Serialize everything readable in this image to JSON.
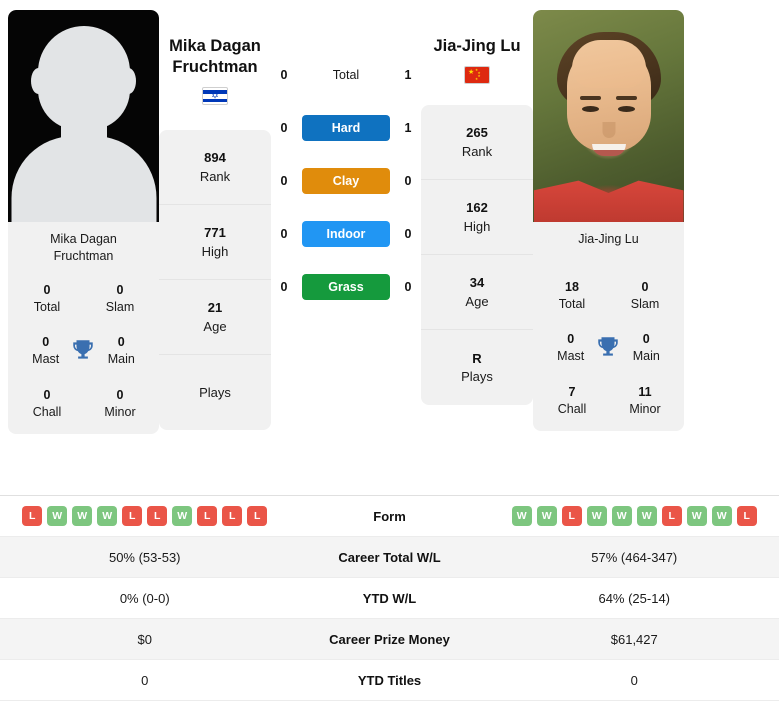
{
  "players": {
    "left": {
      "name": "Mika Dagan Fruchtman",
      "name_line1": "Mika Dagan",
      "name_line2": "Fruchtman",
      "photo_caption_line1": "Mika Dagan",
      "photo_caption_line2": "Fruchtman",
      "country": "Israel",
      "flag_icon": "israel-flag-icon",
      "avatar_type": "placeholder-avatar",
      "info": [
        {
          "value": "894",
          "label": "Rank"
        },
        {
          "value": "771",
          "label": "High"
        },
        {
          "value": "21",
          "label": "Age"
        },
        {
          "value": "",
          "label": "Plays"
        }
      ],
      "titles": [
        {
          "value": "0",
          "label": "Total"
        },
        {
          "value": "0",
          "label": "Slam"
        },
        {
          "value": "0",
          "label": "Mast"
        },
        {
          "value": "0",
          "label": "Main"
        },
        {
          "value": "0",
          "label": "Chall"
        },
        {
          "value": "0",
          "label": "Minor"
        }
      ],
      "form": [
        "L",
        "W",
        "W",
        "W",
        "L",
        "L",
        "W",
        "L",
        "L",
        "L"
      ],
      "career_total_wl": "50% (53-53)",
      "ytd_wl": "0% (0-0)",
      "career_prize_money": "$0",
      "ytd_titles": "0"
    },
    "right": {
      "name": "Jia-Jing Lu",
      "name_line1": "Jia-Jing Lu",
      "name_line2": "",
      "photo_caption_line1": "Jia-Jing Lu",
      "photo_caption_line2": "",
      "country": "China",
      "flag_icon": "china-flag-icon",
      "avatar_type": "player-photo",
      "info": [
        {
          "value": "265",
          "label": "Rank"
        },
        {
          "value": "162",
          "label": "High"
        },
        {
          "value": "34",
          "label": "Age"
        },
        {
          "value": "R",
          "label": "Plays"
        }
      ],
      "titles": [
        {
          "value": "18",
          "label": "Total"
        },
        {
          "value": "0",
          "label": "Slam"
        },
        {
          "value": "0",
          "label": "Mast"
        },
        {
          "value": "0",
          "label": "Main"
        },
        {
          "value": "7",
          "label": "Chall"
        },
        {
          "value": "11",
          "label": "Minor"
        }
      ],
      "form": [
        "W",
        "W",
        "L",
        "W",
        "W",
        "W",
        "L",
        "W",
        "W",
        "L"
      ],
      "career_total_wl": "57% (464-347)",
      "ytd_wl": "64% (25-14)",
      "career_prize_money": "$61,427",
      "ytd_titles": "0"
    }
  },
  "head_to_head": {
    "rows": [
      {
        "label": "Total",
        "left": "0",
        "right": "1",
        "color": ""
      },
      {
        "label": "Hard",
        "left": "0",
        "right": "1",
        "color": "#0f72c0"
      },
      {
        "label": "Clay",
        "left": "0",
        "right": "0",
        "color": "#e08c0c"
      },
      {
        "label": "Indoor",
        "left": "0",
        "right": "0",
        "color": "#2196f3"
      },
      {
        "label": "Grass",
        "left": "0",
        "right": "0",
        "color": "#159a3d"
      }
    ]
  },
  "stats_table": {
    "rows": [
      {
        "label": "Form"
      },
      {
        "label": "Career Total W/L"
      },
      {
        "label": "YTD W/L"
      },
      {
        "label": "Career Prize Money"
      },
      {
        "label": "YTD Titles"
      }
    ]
  },
  "colors": {
    "win_badge": "#7dc67f",
    "loss_badge": "#ea5548",
    "card_bg": "#f1f1f1",
    "trophy": "#3a6fb0",
    "hard": "#0f72c0",
    "clay": "#e08c0c",
    "indoor": "#2196f3",
    "grass": "#159a3d"
  },
  "icons": {
    "trophy": "trophy-icon"
  }
}
